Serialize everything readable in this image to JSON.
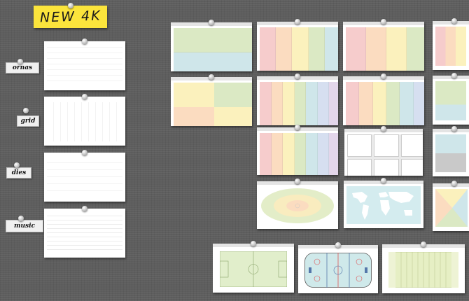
{
  "board": {
    "title_note": "NEW 4K",
    "labels": [
      "ornas",
      "grid",
      "dies",
      "music"
    ]
  },
  "colors": {
    "pastel_green": "#dbe9c4",
    "pastel_blue": "#cfe6ea",
    "pastel_red": "#f6cccc",
    "pastel_orange": "#fbdcc0",
    "pastel_yellow": "#fbf1bd",
    "pastel_purple": "#e3d6ea",
    "board_gray": "#5e5e5e",
    "note_yellow": "#fbe43c"
  },
  "templates": [
    {
      "name": "two-band"
    },
    {
      "name": "rainbow-columns-5"
    },
    {
      "name": "warm-columns-4"
    },
    {
      "name": "quad-grid"
    },
    {
      "name": "rainbow-columns-7"
    },
    {
      "name": "rainbow-columns-6"
    },
    {
      "name": "rainbow-table"
    },
    {
      "name": "six-box-grid"
    },
    {
      "name": "ellipse-target"
    },
    {
      "name": "world-map"
    },
    {
      "name": "soccer-field"
    },
    {
      "name": "hockey-rink"
    },
    {
      "name": "football-field"
    }
  ]
}
